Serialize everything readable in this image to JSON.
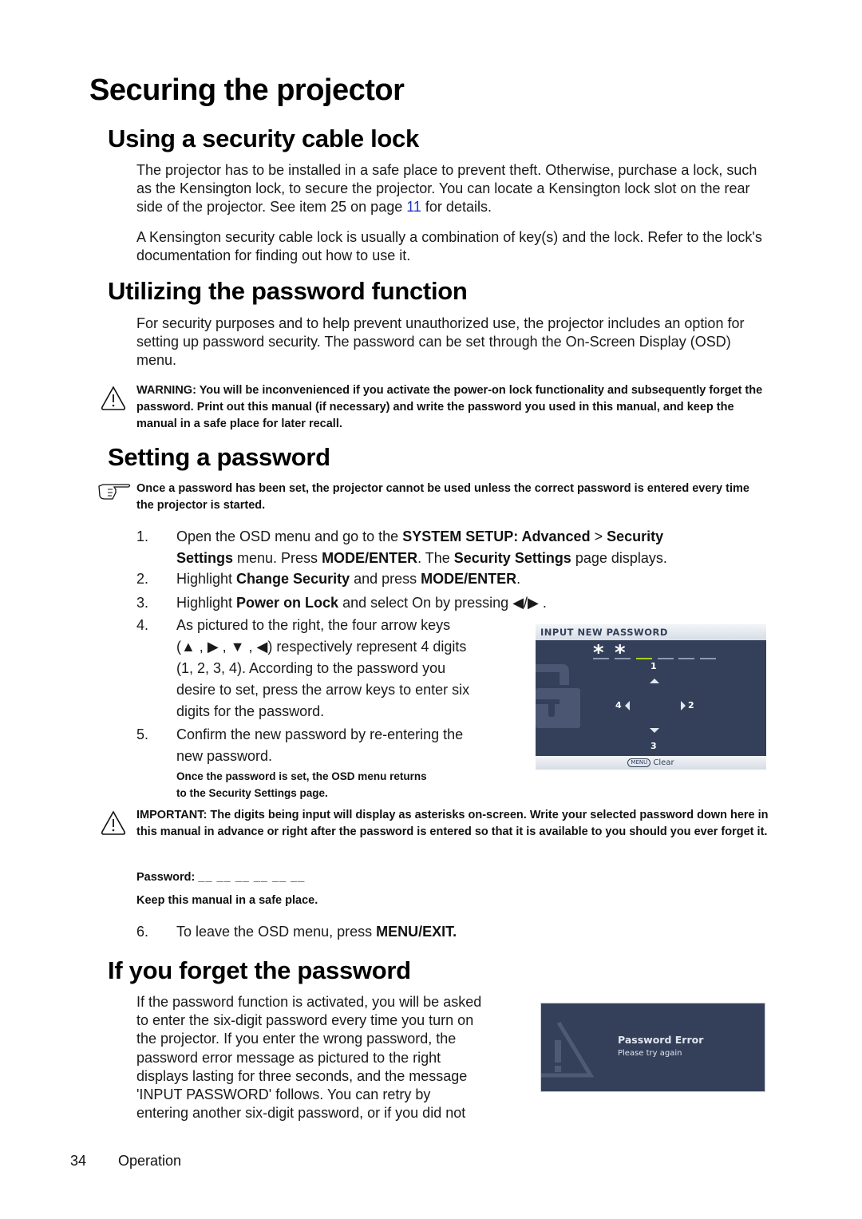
{
  "page": {
    "title": "Securing the projector",
    "page_number": "34",
    "footer_section": "Operation"
  },
  "cable_lock": {
    "heading": "Using a security cable lock",
    "para1_before_link": "The projector has to be installed in a safe place to prevent theft. Otherwise, purchase a lock, such as the Kensington lock, to secure the projector. You can locate a Kensington lock slot on the rear side of the projector. See item 25 on page ",
    "para1_link": "11",
    "para1_after_link": " for details.",
    "para2": "A Kensington security cable lock is usually a combination of key(s) and the lock. Refer to the lock's documentation for finding out how to use it."
  },
  "password_function": {
    "heading": "Utilizing the password function",
    "para": "For security purposes and to help prevent unauthorized use, the projector includes an option for setting up password security. The password can be set through the On-Screen Display (OSD) menu.",
    "warning_label": "WARNING:",
    "warning_text": " You will be inconvenienced if you activate the power-on lock functionality and subsequently forget the password. Print out this manual (if necessary) and write the password you used in this manual, and keep the manual in a safe place for later recall."
  },
  "setting_password": {
    "heading": "Setting a password",
    "note": "Once a password has been set, the projector cannot be used unless the correct password is entered every time the projector is started.",
    "steps": [
      {
        "num": "1.",
        "parts": [
          "Open the OSD menu and go to the ",
          "SYSTEM SETUP: Advanced",
          " > ",
          "Security",
          "Settings",
          " menu. Press ",
          "MODE/ENTER",
          ". The ",
          "Security Settings",
          " page displays."
        ]
      },
      {
        "num": "2.",
        "parts": [
          "Highlight ",
          "Change Security",
          " and press ",
          "MODE/ENTER",
          "."
        ]
      },
      {
        "num": "3.",
        "parts": [
          "Highlight ",
          "Power on Lock",
          " and select On by pressing ",
          "◀/▶",
          " ."
        ]
      },
      {
        "num": "4.",
        "lines": [
          "As pictured to the right, the four arrow keys",
          "(▲ , ▶ , ▼ , ◀) respectively represent 4 digits",
          "(1, 2, 3, 4). According to the password you",
          "desire to set, press the arrow keys to enter six",
          "digits for the password."
        ]
      },
      {
        "num": "5.",
        "lines": [
          "Confirm the new password by re-entering the",
          "new password."
        ],
        "subnote": [
          "Once the password is set, the OSD menu returns",
          "to the Security Settings page."
        ]
      },
      {
        "num": "6.",
        "parts": [
          "To leave the OSD menu, press ",
          "MENU/EXIT."
        ]
      }
    ],
    "important_label": "IMPORTANT:",
    "important_text": " The digits being input will display as asterisks on-screen. Write your selected password down here in this manual in advance or right after the password is entered so that it is available to you should you ever forget it.",
    "password_label": "Password:",
    "password_blanks": "__ __ __ __ __ __",
    "keep_safe": "Keep this manual in a safe place."
  },
  "osd_input": {
    "header": "INPUT NEW PASSWORD",
    "asterisks": [
      "*",
      "*"
    ],
    "entered_count": 2,
    "total_slots": 6,
    "digit_up": "1",
    "digit_right": "2",
    "digit_down": "3",
    "digit_left": "4",
    "menu_button": "MENU",
    "footer_action": "Clear",
    "accent_color": "#a8d020",
    "bg_color": "#34405a"
  },
  "forget_password": {
    "heading": "If you forget the password",
    "lines": [
      "If the password function is activated, you will be asked",
      "to enter the six-digit password every time you turn on",
      "the projector. If you enter the wrong password, the",
      "password error message as pictured to the right",
      "displays lasting for three seconds, and the message",
      "'INPUT PASSWORD' follows. You can retry by",
      "entering another six-digit password, or if you did not"
    ]
  },
  "osd_error": {
    "title": "Password Error",
    "message": "Please try again"
  }
}
